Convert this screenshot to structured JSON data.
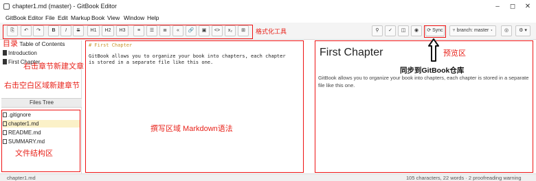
{
  "window": {
    "title": "chapter1.md (master) - GitBook Editor",
    "controls": [
      "–",
      "◻",
      "✕"
    ]
  },
  "menu": [
    "GitBook Editor",
    "File",
    "Edit",
    "Markup",
    "Book",
    "View",
    "Window",
    "Help"
  ],
  "toolbar": {
    "format_buttons": [
      {
        "icon": "save-icon",
        "glyph": "⎘"
      },
      {
        "icon": "undo-icon",
        "glyph": "↶"
      },
      {
        "icon": "redo-icon",
        "glyph": "↷"
      },
      {
        "icon": "bold-icon",
        "glyph": "B"
      },
      {
        "icon": "italic-icon",
        "glyph": "I"
      },
      {
        "icon": "strikethrough-icon",
        "glyph": "S"
      },
      {
        "icon": "heading1-icon",
        "glyph": "H1"
      },
      {
        "icon": "heading2-icon",
        "glyph": "H2"
      },
      {
        "icon": "heading3-icon",
        "glyph": "H3"
      },
      {
        "icon": "unordered-list-icon",
        "glyph": "≡"
      },
      {
        "icon": "ordered-list-icon",
        "glyph": "☰"
      },
      {
        "icon": "quote-icon",
        "glyph": "≣"
      },
      {
        "icon": "code-block-icon",
        "glyph": "«"
      },
      {
        "icon": "link-icon",
        "glyph": "🔗"
      },
      {
        "icon": "image-icon",
        "glyph": "▣"
      },
      {
        "icon": "code-inline-icon",
        "glyph": "<>"
      },
      {
        "icon": "math-icon",
        "glyph": "x₂"
      },
      {
        "icon": "table-icon",
        "glyph": "⊞"
      }
    ],
    "right_buttons": [
      {
        "icon": "glossary-icon",
        "glyph": "⚲"
      },
      {
        "icon": "check-icon",
        "glyph": "✓"
      },
      {
        "icon": "layout-icon",
        "glyph": "◫"
      },
      {
        "icon": "eye-icon",
        "glyph": "◉"
      }
    ],
    "sync_label": "⟳ Sync",
    "branch_label": "⑂ branch: master ▾",
    "help_glyph": "◎",
    "settings_glyph": "⚙ ▾"
  },
  "annotations": {
    "format_tools": "格式化工具",
    "toc_area": "目录",
    "new_chapter_file": "右击章节新建文章",
    "new_chapter_blank": "右击空白区域新建章节",
    "file_structure": "文件结构区",
    "editor_area": "撰写区域 Markdown语法",
    "preview_area": "预览区",
    "sync_note": "同步到GitBook仓库"
  },
  "sidebar": {
    "toc_header": "Table of Contents",
    "toc_items": [
      "Introduction",
      "First Chapter"
    ],
    "files_tree_label": "Files Tree",
    "files": [
      {
        "name": ".gitignore",
        "selected": false
      },
      {
        "name": "chapter1.md",
        "selected": true
      },
      {
        "name": "README.md",
        "selected": false
      },
      {
        "name": "SUMMARY.md",
        "selected": false
      }
    ]
  },
  "editor": {
    "line1": "# First Chapter",
    "line2": "GitBook allows you to organize your book into chapters, each chapter",
    "line3": "is stored in a separate file like this one."
  },
  "preview": {
    "heading": "First Chapter",
    "paragraph": "GitBook allows you to organize your book into chapters, each chapter is stored in a separate file like this one."
  },
  "status": {
    "filename": "chapter1.md",
    "stats": "105 characters, 22 words · 2 proofreading warning"
  },
  "colors": {
    "annotation_red": "#e8231b",
    "selected_file": "#fbf1c8",
    "heading_markup": "#c8942a"
  }
}
